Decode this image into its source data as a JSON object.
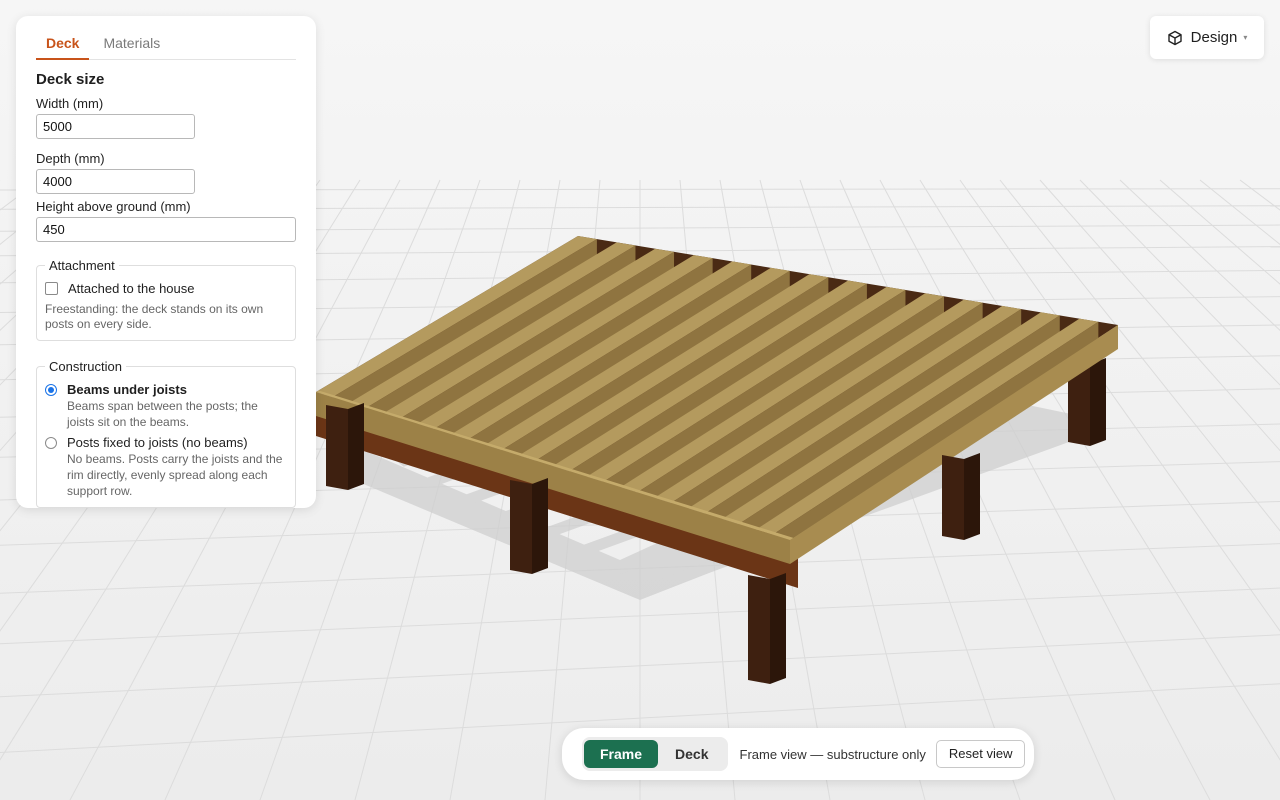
{
  "tabs": [
    {
      "label": "Deck",
      "active": true
    },
    {
      "label": "Materials",
      "active": false
    }
  ],
  "deck_size": {
    "title": "Deck size",
    "width_label": "Width (mm)",
    "width_value": "5000",
    "depth_label": "Depth (mm)",
    "depth_value": "4000",
    "height_label": "Height above ground (mm)",
    "height_value": "450"
  },
  "attachment": {
    "legend": "Attachment",
    "checkbox_label": "Attached to the house",
    "checked": false,
    "hint": "Freestanding: the deck stands on its own posts on every side."
  },
  "construction": {
    "legend": "Construction",
    "options": [
      {
        "title": "Beams under joists",
        "desc": "Beams span between the posts; the joists sit on the beams.",
        "selected": true
      },
      {
        "title": "Posts fixed to joists (no beams)",
        "desc": "No beams. Posts carry the joists and the rim directly, evenly spread along each support row.",
        "selected": false
      }
    ]
  },
  "design_button": {
    "label": "Design",
    "icon": "cube-icon"
  },
  "toolbar": {
    "frame_label": "Frame",
    "deck_label": "Deck",
    "active_view": "Frame",
    "status": "Frame view — substructure only",
    "reset_label": "Reset view"
  },
  "colors": {
    "accent": "#c8531a",
    "primary": "#1c7050",
    "radio": "#1a73e8",
    "joist_top": "#b49a5e",
    "joist_side": "#8f7440",
    "beam": "#6b3516",
    "post": "#3e2010",
    "ground": "#f1f1f1"
  }
}
